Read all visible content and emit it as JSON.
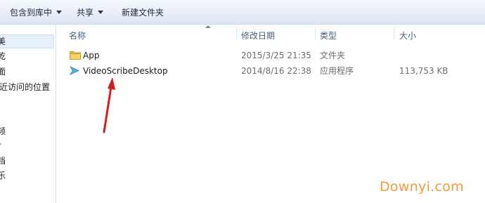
{
  "toolbar": {
    "include_in_library": "包含到库中",
    "share": "共享",
    "new_folder": "新建文件夹"
  },
  "nav": {
    "items": [
      "美",
      "乾",
      "面",
      "近访问的位置",
      "频",
      "†",
      "档",
      "乐"
    ]
  },
  "columns": {
    "name": "名称",
    "modified": "修改日期",
    "type": "类型",
    "size": "大小"
  },
  "files": [
    {
      "name": "App",
      "modified": "2015/3/25 21:35",
      "type": "文件夹",
      "size": "",
      "icon": "folder-icon"
    },
    {
      "name": "VideoScribeDesktop",
      "modified": "2014/8/16 22:38",
      "type": "应用程序",
      "size": "113,753 KB",
      "icon": "videoscribe-app-icon"
    }
  ],
  "annotation": {
    "arrow_color": "#d21f1f"
  },
  "watermark": "Downyi.com",
  "colors": {
    "toolbar_bg": "#e9f0f8",
    "header_text": "#4c607a",
    "selection": "#e6f0fb",
    "watermark": "#f19a3a"
  }
}
